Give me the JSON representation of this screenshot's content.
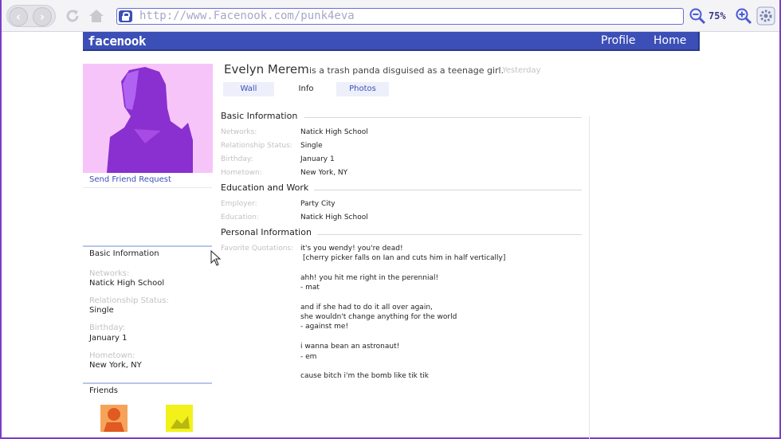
{
  "browser": {
    "url": "http://www.Facenook.com/punk4eva",
    "zoom": "75%",
    "back_glyph": "‹",
    "forward_glyph": "›",
    "icons": [
      "back-icon",
      "forward-icon",
      "reload-icon",
      "home-icon",
      "lock-icon",
      "zoom-out-icon",
      "zoom-in-icon",
      "settings-gear-icon"
    ]
  },
  "header": {
    "logo": "facenook",
    "nav": [
      "Profile",
      "Home"
    ],
    "color": "#3b4fb7"
  },
  "sidebar": {
    "send_friend_request": "Send Friend Request",
    "basic_info": {
      "title": "Basic Information",
      "rows": [
        {
          "label": "Networks:",
          "value": "Natick High School"
        },
        {
          "label": "Relationship Status:",
          "value": "Single"
        },
        {
          "label": "Birthday:",
          "value": "January 1"
        },
        {
          "label": "Hometown:",
          "value": "New York, NY"
        }
      ]
    },
    "friends": {
      "title": "Friends"
    }
  },
  "profile": {
    "name": "Evelyn Merem",
    "status": "is a trash panda disguised as a teenage girl.",
    "time": "Yesterday",
    "tabs": [
      {
        "label": "Wall"
      },
      {
        "label": "Info"
      },
      {
        "label": "Photos"
      }
    ]
  },
  "info": {
    "basic": {
      "title": "Basic Information",
      "rows": [
        {
          "label": "Networks:",
          "value": "Natick High School"
        },
        {
          "label": "Relationship Status:",
          "value": "Single"
        },
        {
          "label": "Birthday:",
          "value": "January 1"
        },
        {
          "label": "Hometown:",
          "value": "New York, NY"
        }
      ]
    },
    "education": {
      "title": "Education and Work",
      "rows": [
        {
          "label": "Employer:",
          "value": "Party City"
        },
        {
          "label": "Education:",
          "value": "Natick High School"
        }
      ]
    },
    "personal": {
      "title": "Personal Information",
      "quotes_label": "Favorite Quotations:",
      "quotes": [
        "it's you wendy! you're dead!",
        "[cherry picker falls on Ian and cuts him in half vertically]",
        "",
        "ahh! you hit me right in the perennial!",
        "- mat",
        "",
        "and if she had to do it all over again,",
        "she wouldn't change anything for the world",
        "- against me!",
        "",
        "i wanna bean an astronaut!",
        "- em",
        "",
        "cause bitch i'm the bomb like tik tik"
      ]
    }
  }
}
